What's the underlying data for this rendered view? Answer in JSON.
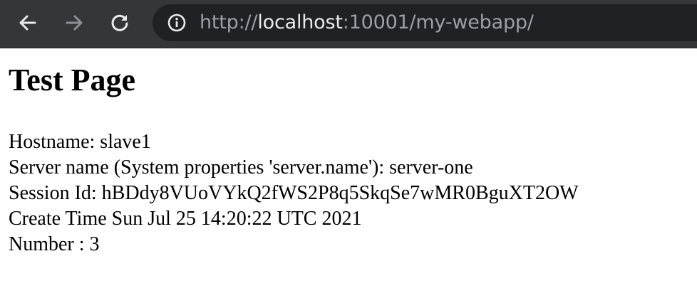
{
  "browser": {
    "icons": {
      "back": "back-arrow-icon",
      "forward": "forward-arrow-icon",
      "reload": "reload-icon",
      "site_info": "info-icon"
    },
    "colors": {
      "toolbar_bg": "#35363a",
      "omnibox_bg": "#202124",
      "url_dim": "#9aa0a6",
      "url_host": "#e8eaed",
      "icon_active": "#e8eaed",
      "icon_disabled": "#8e9095"
    },
    "url": {
      "scheme": "http://",
      "host": "localhost",
      "rest": ":10001/my-webapp/"
    }
  },
  "page": {
    "title": "Test Page",
    "lines": {
      "hostname": "Hostname: slave1",
      "server_name": "Server name (System properties 'server.name'): server-one",
      "session_id": "Session Id: hBDdy8VUoVYkQ2fWS2P8q5SkqSe7wMR0BguXT2OW",
      "create_time": "Create Time Sun Jul 25 14:20:22 UTC 2021",
      "number": "Number : 3"
    }
  }
}
